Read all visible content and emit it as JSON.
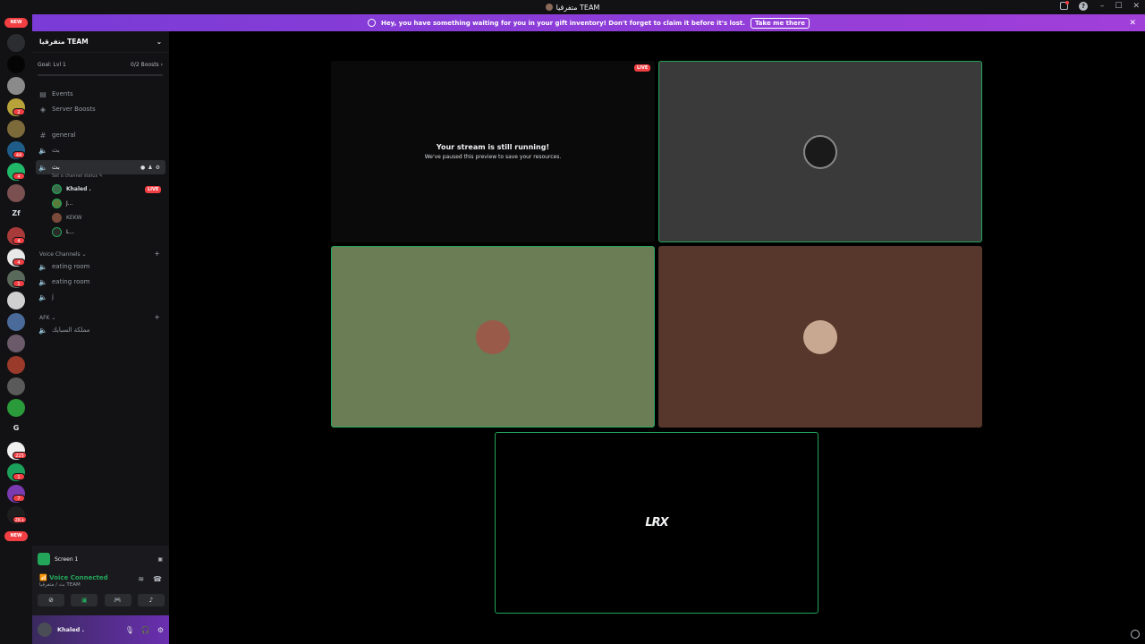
{
  "titlebar": {
    "title": "متفرقيا TEAM"
  },
  "banner": {
    "message": "Hey, you have something waiting for you in your gift inventory! Don't forget to claim it before it's lost.",
    "cta": "Take me there"
  },
  "servers": {
    "new_top": "NEW",
    "new_bottom": "NEW",
    "letters": [
      "Zf",
      "G"
    ],
    "badges": [
      "2",
      "44",
      "4",
      "4",
      "4",
      "1",
      "225",
      "1",
      "7",
      "2K+"
    ]
  },
  "guild": {
    "name": "متفرقيا TEAM",
    "goal_label": "Goal: Lvl 1",
    "boosts": "0/2 Boosts",
    "items": [
      {
        "label": "Events"
      },
      {
        "label": "Server Boosts"
      }
    ],
    "text_channel": "general",
    "voice_channel_1": "بث",
    "active_channel": "بث",
    "channel_status_hint": "Set a channel status",
    "voice_users": [
      {
        "name": "Khaled .",
        "live": "LIVE"
      },
      {
        "name": "J..."
      },
      {
        "name": "KEKW"
      },
      {
        "name": "L..."
      }
    ],
    "category_voice": "Voice Channels",
    "voice_channels": [
      "eating room",
      "eating room",
      "j"
    ],
    "category_afk": "AFK",
    "afk_channel": "مملكة السبايك"
  },
  "bottom": {
    "screen_label": "Screen 1",
    "vc_status": "Voice Connected",
    "vc_sub": "بث / متفرقيا TEAM",
    "user_name": "Khaled ."
  },
  "stage": {
    "live": "LIVE",
    "stream_title": "Your stream is still running!",
    "stream_sub": "We've paused this preview to save your resources.",
    "logo": "LRX"
  },
  "colors": {
    "accent": "#5865f2",
    "speaking": "#23a55a",
    "live": "#f23f43",
    "banner": "#8b3dd9"
  }
}
